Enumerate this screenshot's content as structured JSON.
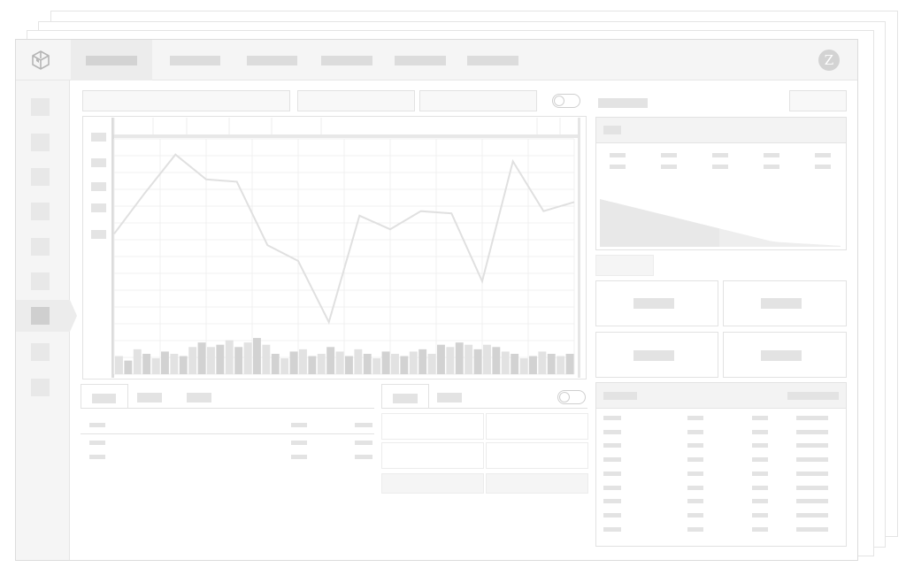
{
  "app": {
    "logo_icon": "cube-logo-icon",
    "avatar_initial": "Z",
    "accent_gray": "#d6d6d6"
  },
  "top_nav": {
    "tabs": [
      {
        "label": "",
        "active": true
      },
      {
        "label": "",
        "active": false
      },
      {
        "label": "",
        "active": false
      },
      {
        "label": "",
        "active": false
      },
      {
        "label": "",
        "active": false
      },
      {
        "label": "",
        "active": false
      }
    ]
  },
  "sidebar": {
    "items": [
      "item-1",
      "item-2",
      "item-3",
      "item-4",
      "item-5",
      "item-6",
      "item-7",
      "item-8",
      "item-9"
    ],
    "active_index": 6
  },
  "chart_data": {
    "type": "line",
    "title": "",
    "xlabel": "",
    "ylabel": "",
    "ylim": [
      0,
      100
    ],
    "grid": true,
    "line": {
      "values": [
        62,
        80,
        97,
        86,
        85,
        57,
        50,
        23,
        70,
        64,
        72,
        71,
        41,
        94,
        72,
        76
      ]
    },
    "bars": {
      "values": [
        8,
        6,
        11,
        9,
        7,
        10,
        9,
        8,
        12,
        14,
        12,
        13,
        15,
        12,
        14,
        16,
        13,
        9,
        7,
        10,
        11,
        8,
        9,
        12,
        10,
        8,
        11,
        9,
        7,
        10,
        9,
        8,
        10,
        11,
        9,
        13,
        12,
        14,
        13,
        11,
        13,
        12,
        10,
        9,
        7,
        8,
        10,
        9,
        8,
        9
      ]
    }
  },
  "right_top_panel": {
    "area_series": [
      100,
      96,
      92,
      88,
      84,
      80,
      76,
      72,
      68,
      64,
      60,
      56,
      52,
      48,
      44,
      40,
      36,
      32,
      28,
      24,
      20,
      16,
      12,
      10,
      9,
      8,
      7,
      6,
      5,
      4,
      3,
      2
    ]
  },
  "bottom_left_tabs": [
    "",
    "",
    ""
  ],
  "bottom_mid_tabs": [
    "",
    ""
  ],
  "right_table": {
    "rows": 9
  }
}
